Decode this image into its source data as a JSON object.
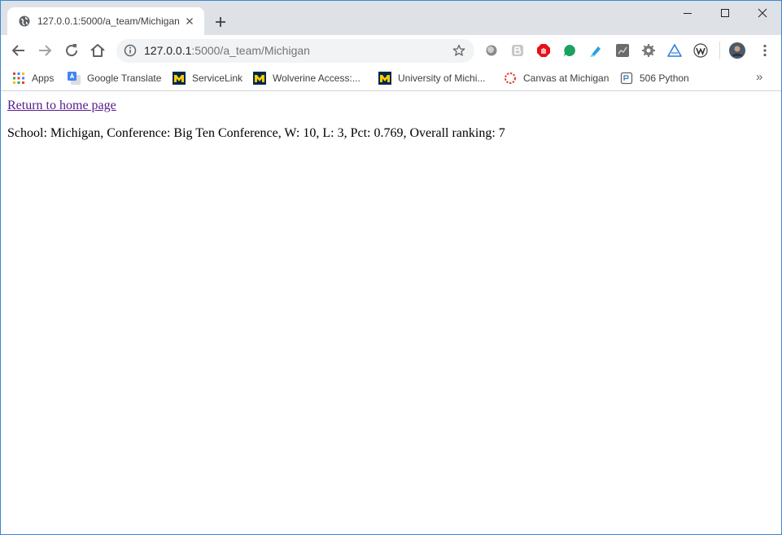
{
  "tab": {
    "title": "127.0.0.1:5000/a_team/Michigan"
  },
  "address_bar": {
    "host": "127.0.0.1",
    "path": ":5000/a_team/Michigan"
  },
  "bookmarks": [
    {
      "label": "Apps"
    },
    {
      "label": "Google Translate"
    },
    {
      "label": "ServiceLink"
    },
    {
      "label": "Wolverine Access:..."
    },
    {
      "label": "University of Michi..."
    },
    {
      "label": "Canvas at Michigan"
    },
    {
      "label": "506 Python"
    }
  ],
  "bookmarks_overflow": "»",
  "page": {
    "link_text": "Return to home page",
    "team_info": "School: Michigan, Conference: Big Ten Conference, W: 10, L: 3, Pct: 0.769, Overall ranking: 7"
  },
  "colors": {
    "frame": "#dee1e6",
    "link_visited": "#551a8b",
    "window_border": "#3c86d0"
  }
}
